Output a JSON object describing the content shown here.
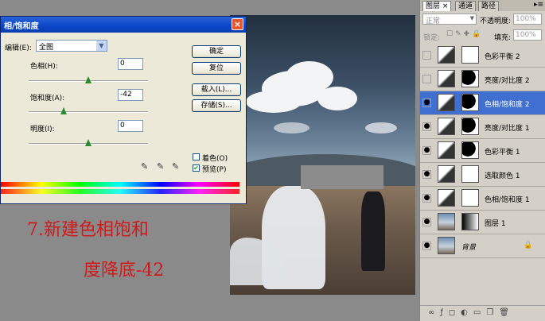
{
  "dialog": {
    "title": "相/饱和度",
    "close": "×",
    "edit_label": "编辑(E):",
    "edit_value": "全图",
    "hue_label": "色相(H):",
    "hue_value": "0",
    "hue_level_pct": 50,
    "saturation_label": "饱和度(A):",
    "saturation_value": "-42",
    "saturation_level_pct": 29,
    "lightness_label": "明度(I):",
    "lightness_value": "0",
    "lightness_level_pct": 50,
    "buttons": {
      "ok": "确定",
      "reset": "复位",
      "load": "载入(L)...",
      "save": "存储(S)..."
    },
    "colorize_label": "着色(O)",
    "colorize_checked": false,
    "preview_label": "预览(P)",
    "preview_checked": true
  },
  "caption": {
    "line1": "7.新建色相饱和",
    "line2": "度降底-42",
    "color": "#d0191b"
  },
  "layers_panel": {
    "tabs": [
      "图层",
      "通道",
      "路径"
    ],
    "blend_mode": "正常",
    "opacity_label": "不透明度:",
    "opacity_value": "100%",
    "lock_label": "锁定:",
    "fill_label": "填充:",
    "fill_value": "100%",
    "layers": [
      {
        "name": "色彩平衡 2",
        "visible": false,
        "selected": false,
        "kind": "adjust",
        "mask": "white"
      },
      {
        "name": "亮度/对比度 2",
        "visible": false,
        "selected": false,
        "kind": "adjust",
        "mask": "black-shape"
      },
      {
        "name": "色相/饱和度 2",
        "visible": true,
        "selected": true,
        "kind": "adjust",
        "mask": "black-shape"
      },
      {
        "name": "亮度/对比度 1",
        "visible": true,
        "selected": false,
        "kind": "adjust",
        "mask": "black-shape"
      },
      {
        "name": "色彩平衡 1",
        "visible": true,
        "selected": false,
        "kind": "adjust",
        "mask": "black-shape"
      },
      {
        "name": "选取颜色 1",
        "visible": true,
        "selected": false,
        "kind": "adjust",
        "mask": "white"
      },
      {
        "name": "色相/饱和度 1",
        "visible": true,
        "selected": false,
        "kind": "adjust",
        "mask": "white"
      },
      {
        "name": "图层 1",
        "visible": true,
        "selected": false,
        "kind": "image",
        "mask": "gradient"
      },
      {
        "name": "背景",
        "visible": true,
        "selected": false,
        "kind": "image",
        "mask": "none"
      }
    ],
    "footer_icons": [
      "link-icon",
      "fx-icon",
      "mask-icon",
      "adjustment-icon",
      "folder-icon",
      "new-layer-icon",
      "trash-icon"
    ]
  }
}
